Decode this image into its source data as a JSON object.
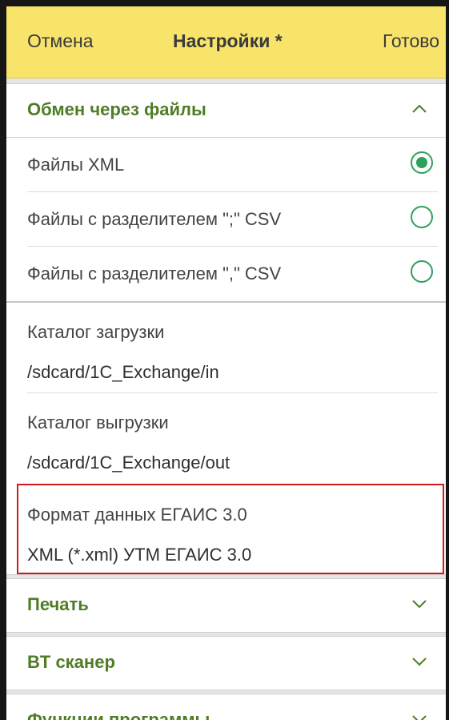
{
  "header": {
    "cancel_label": "Отмена",
    "title": "Настройки *",
    "done_label": "Готово"
  },
  "exchange": {
    "title": "Обмен через файлы",
    "expanded": true,
    "file_options": [
      {
        "label": "Файлы XML",
        "selected": true
      },
      {
        "label": "Файлы с разделителем \";\" CSV",
        "selected": false
      },
      {
        "label": "Файлы с разделителем \",\" CSV",
        "selected": false
      }
    ],
    "import_dir": {
      "label": "Каталог загрузки",
      "value": "/sdcard/1C_Exchange/in"
    },
    "export_dir": {
      "label": "Каталог выгрузки",
      "value": "/sdcard/1C_Exchange/out"
    },
    "egais_format": {
      "label": "Формат данных ЕГАИС 3.0",
      "value": "XML (*.xml)  УТМ ЕГАИС 3.0"
    }
  },
  "sections": [
    {
      "title": "Печать",
      "expanded": false
    },
    {
      "title": "BT сканер",
      "expanded": false
    },
    {
      "title": "Функции программы",
      "expanded": false
    }
  ],
  "colors": {
    "header_bg": "#f8e46b",
    "section_title": "#4f7c25",
    "radio_accent": "#2fa05a",
    "highlight_border": "#d21a1a"
  }
}
